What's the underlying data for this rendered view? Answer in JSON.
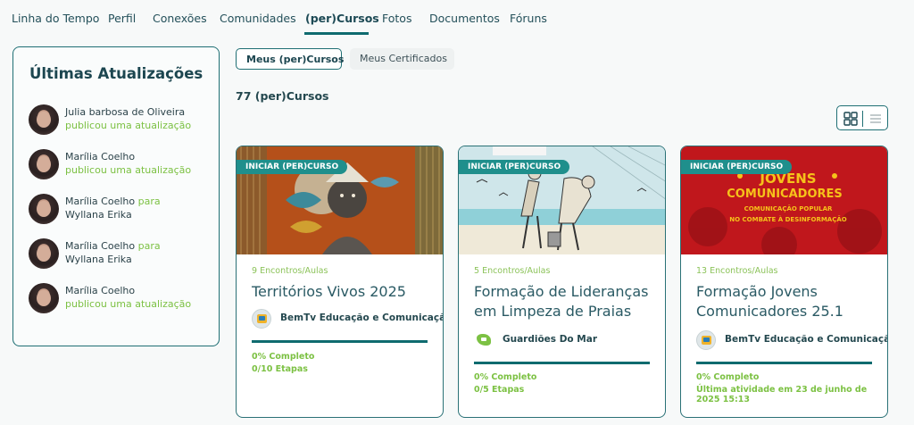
{
  "nav": {
    "tabs": [
      "Linha do Tempo",
      "Perfil",
      "Conexões",
      "Comunidades",
      "(per)Cursos",
      "Fotos",
      "Documentos",
      "Fóruns"
    ],
    "active": "(per)Cursos"
  },
  "updates": {
    "title": "Últimas Atualizações",
    "items": [
      {
        "name": "Julia barbosa de Oliveira",
        "action": "publicou uma atualização"
      },
      {
        "name": "Marília Coelho",
        "action": "publicou uma atualização"
      },
      {
        "name": "Marília Coelho",
        "connector": "para",
        "target": "Wyllana Erika"
      },
      {
        "name": "Marília Coelho",
        "connector": "para",
        "target": "Wyllana Erika"
      },
      {
        "name": "Marília Coelho",
        "action": "publicou uma atualização"
      }
    ]
  },
  "tabs2": {
    "active": "Meus (per)Cursos",
    "inactive": "Meus Certificados"
  },
  "count": "77 (per)Cursos",
  "view_toggle": {
    "icons": [
      "grid-icon",
      "list-icon"
    ],
    "active": "grid"
  },
  "cards": [
    {
      "badge": "INICIAR (PER)CURSO",
      "meta": "9 Encontros/Aulas",
      "title": "Territórios Vivos 2025",
      "org": "BemTv Educação e Comunicação",
      "progress": "0% Completo",
      "steps": "0/10 Etapas",
      "progress_value": 0
    },
    {
      "badge": "INICIAR (PER)CURSO",
      "meta": "5 Encontros/Aulas",
      "title": "Formação de Lideranças em Limpeza de Praias",
      "org": "Guardiões Do Mar",
      "progress": "0% Completo",
      "steps": "0/5 Etapas",
      "progress_value": 0
    },
    {
      "badge": "INICIAR (PER)CURSO",
      "meta": "13 Encontros/Aulas",
      "title": "Formação Jovens Comunicadores 25.1",
      "org": "BemTv Educação e Comunicação",
      "progress": "0% Completo",
      "steps": "Última atividade em 23 de junho de 2025 15:13",
      "progress_value": 0,
      "banner_text": [
        "JOVENS",
        "COMUNICADORES",
        "COMUNICAÇÃO POPULAR",
        "NO COMBATE À DESINFORMAÇÃO"
      ]
    }
  ],
  "colors": {
    "accent": "#0f6b6f",
    "green": "#7cc143",
    "badge": "#1f8f8c"
  }
}
